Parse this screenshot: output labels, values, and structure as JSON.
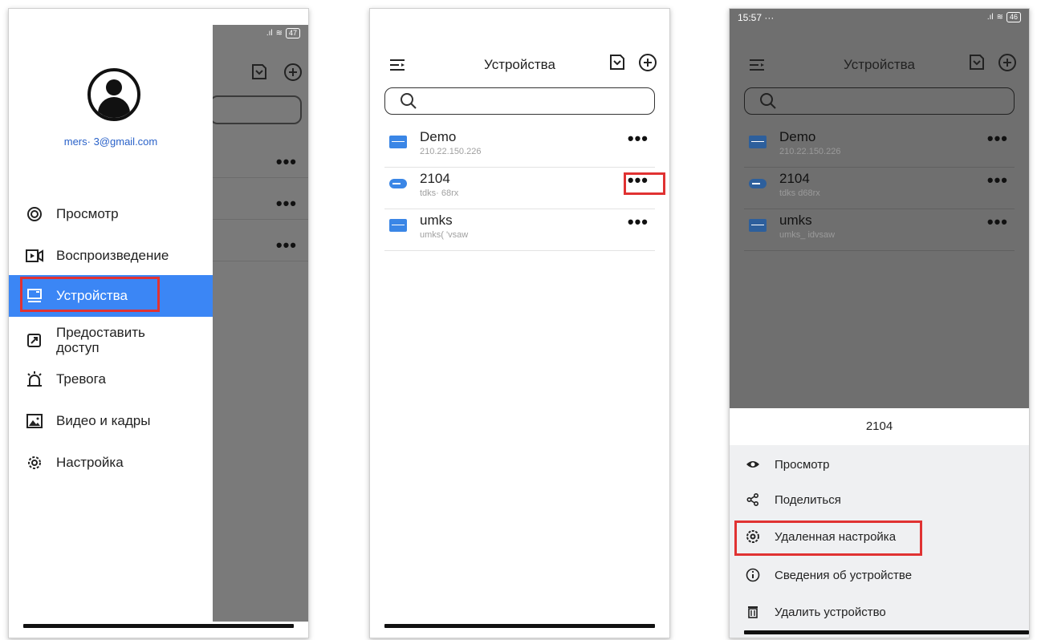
{
  "drawer_screen": {
    "status": {
      "battery": "47"
    },
    "account": {
      "email": "mers·     3@gmail.com"
    },
    "menu": [
      {
        "label": "Просмотр",
        "icon": "live-view-icon"
      },
      {
        "label": "Воспроизведение",
        "icon": "playback-icon"
      },
      {
        "label": "Устройства",
        "icon": "devices-icon",
        "active": true
      },
      {
        "label": "Предоставить доступ",
        "icon": "share-access-icon"
      },
      {
        "label": "Тревога",
        "icon": "alarm-icon"
      },
      {
        "label": "Видео и кадры",
        "icon": "gallery-icon"
      },
      {
        "label": "Настройка",
        "icon": "settings-icon"
      }
    ],
    "more_label": "•••"
  },
  "devices_screen": {
    "title": "Устройства",
    "search": {
      "placeholder": ""
    },
    "devices": [
      {
        "name": "Demo",
        "sub": "210.22.150.226",
        "type": "dvr"
      },
      {
        "name": "2104",
        "sub": "tdks·   68rx",
        "type": "nvr"
      },
      {
        "name": "umks",
        "sub": "umks(     'vsaw",
        "type": "dvr"
      }
    ],
    "more_label": "•••"
  },
  "action_screen": {
    "status": {
      "time": "15:57",
      "dots": "···",
      "battery": "46"
    },
    "title": "Устройства",
    "devices": [
      {
        "name": "Demo",
        "sub": "210.22.150.226"
      },
      {
        "name": "2104",
        "sub": "tdks   d68rx"
      },
      {
        "name": "umks",
        "sub": "umks_   idvsaw"
      }
    ],
    "more_label": "•••",
    "sheet": {
      "title": "2104",
      "items": [
        {
          "label": "Просмотр",
          "icon": "eye-icon"
        },
        {
          "label": "Поделиться",
          "icon": "share-icon"
        },
        {
          "label": "Удаленная настройка",
          "icon": "remote-settings-icon"
        },
        {
          "label": "Сведения об устройстве",
          "icon": "info-icon"
        },
        {
          "label": "Удалить устройство",
          "icon": "trash-icon"
        }
      ]
    }
  },
  "colors": {
    "accent": "#3b86f5",
    "highlight": "#e03232",
    "device_icon": "#3a86e6",
    "overlay": "#7a7a7a"
  }
}
